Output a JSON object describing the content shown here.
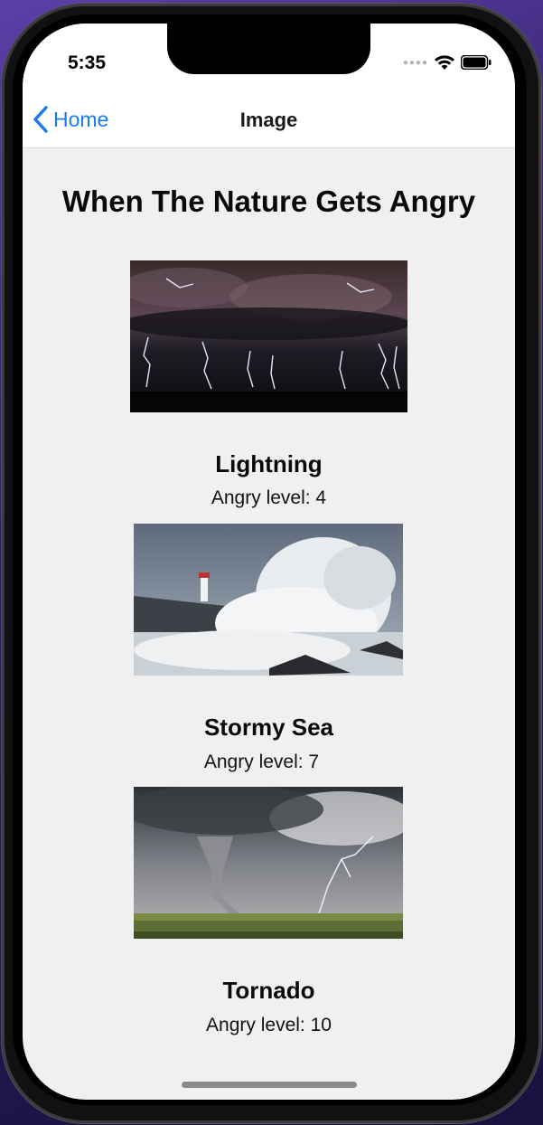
{
  "status_bar": {
    "time": "5:35",
    "signal_icon": "cellular-dots-icon",
    "wifi_icon": "wifi-icon",
    "battery_icon": "battery-icon"
  },
  "nav": {
    "back_label": "Home",
    "back_icon": "chevron-left-icon",
    "title": "Image"
  },
  "page": {
    "heading": "When The Nature Gets Angry"
  },
  "colors": {
    "accent": "#1a7cf0",
    "background": "#f0f0f0"
  },
  "cards": [
    {
      "title": "Lightning",
      "level_text": "Angry level: 4"
    },
    {
      "title": "Stormy Sea",
      "level_text": "Angry level: 7"
    },
    {
      "title": "Tornado",
      "level_text": "Angry level: 10"
    }
  ]
}
